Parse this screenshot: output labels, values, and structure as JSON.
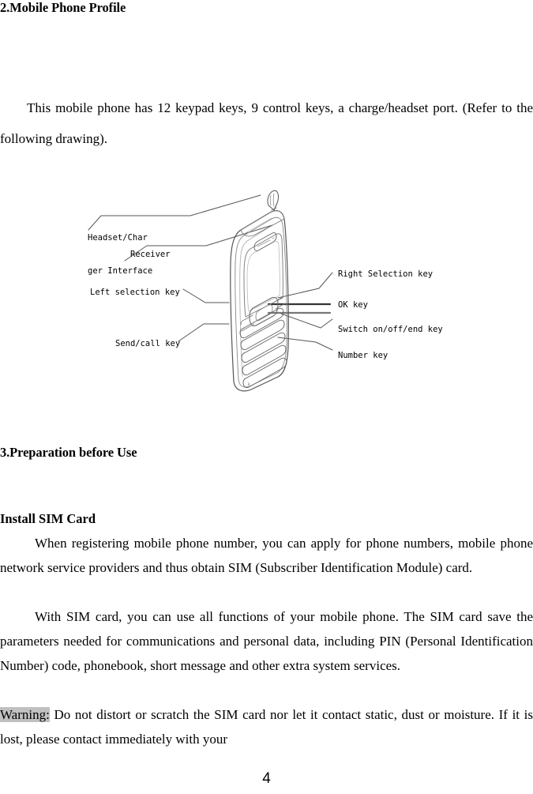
{
  "document": {
    "page_number": "4"
  },
  "sections": {
    "profile": {
      "heading": "2.Mobile Phone Profile",
      "paragraph": "This mobile phone has 12 keypad keys, 9 control keys, a charge/headset port. (Refer to the following drawing)."
    },
    "preparation": {
      "heading": "3.Preparation before Use",
      "subheading": "Install SIM Card",
      "paragraph_1": "When registering mobile phone number, you can apply for phone numbers, mobile phone network service providers and thus obtain SIM (Subscriber Identification Module) card.",
      "paragraph_2": "With SIM card, you can use all functions of your mobile phone. The SIM card save the parameters needed for communications and personal data, including PIN (Personal Identification Number) code, phonebook, short message and other extra system services.",
      "warning_label": "Warning:",
      "warning_text": " Do not distort or scratch the SIM card nor let it contact static, dust or moisture. If it is lost, please contact immediately with your"
    }
  },
  "diagram": {
    "name": "mobile-phone-callout-drawing",
    "labels_left": [
      {
        "id": "headset-charger-interface",
        "line_1": "Headset/Char",
        "line_2": "ger Interface"
      },
      {
        "id": "receiver",
        "line_1": "Receiver"
      },
      {
        "id": "left-selection-key",
        "line_1": "Left selection key"
      },
      {
        "id": "send-call-key",
        "line_1": "Send/call key"
      }
    ],
    "labels_right": [
      {
        "id": "right-selection-key",
        "line_1": "Right Selection key"
      },
      {
        "id": "ok-key",
        "line_1": "OK key"
      },
      {
        "id": "switch-on-off-end-key",
        "line_1": "Switch on/off/end key"
      },
      {
        "id": "number-key",
        "line_1": "Number key"
      }
    ]
  },
  "colors": {
    "text": "#000000",
    "highlight": "#c0c0c0",
    "page_background": "#ffffff",
    "line_art": "#333333"
  }
}
